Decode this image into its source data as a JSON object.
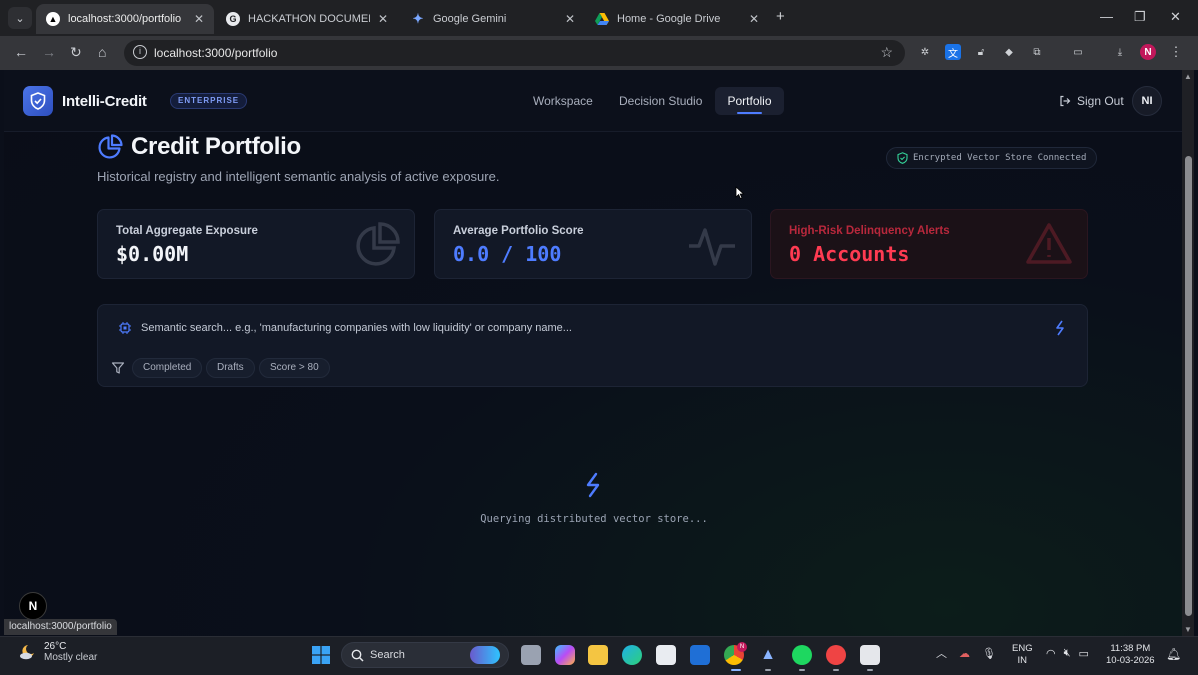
{
  "browser": {
    "tabs": [
      {
        "title": "localhost:3000/portfolio",
        "active": true
      },
      {
        "title": "HACKATHON DOCUMENTATIO",
        "active": false
      },
      {
        "title": "Google Gemini",
        "active": false
      },
      {
        "title": "Home - Google Drive",
        "active": false
      }
    ],
    "new_tab": "+",
    "url": "localhost:3000/portfolio",
    "profile_initial": "N",
    "status_url": "localhost:3000/portfolio"
  },
  "app": {
    "brand": "Intelli-Credit",
    "badge": "ENTERPRISE",
    "nav": [
      "Workspace",
      "Decision Studio",
      "Portfolio"
    ],
    "active_nav": "Portfolio",
    "sign_out": "Sign Out",
    "avatar_initials": "NI"
  },
  "page": {
    "title": "Credit Portfolio",
    "subtitle": "Historical registry and intelligent semantic analysis of active exposure.",
    "vector_status": "Encrypted Vector Store Connected",
    "cards": [
      {
        "label": "Total Aggregate Exposure",
        "value": "$0.00M",
        "accent": "#f2f4f8"
      },
      {
        "label": "Average Portfolio Score",
        "value": "0.0 / 100",
        "accent": "#4e7cff"
      },
      {
        "label": "High-Risk Delinquency Alerts",
        "value": "0 Accounts",
        "accent": "#ff3b52"
      }
    ],
    "search_placeholder": "Semantic search... e.g., 'manufacturing companies with low liquidity' or company name...",
    "filters": [
      "Completed",
      "Drafts",
      "Score > 80"
    ],
    "loading_text": "Querying distributed vector store...",
    "dev_badge": "N"
  },
  "taskbar": {
    "temperature": "26°C",
    "weather": "Mostly clear",
    "search_label": "Search",
    "chrome_badge": "N",
    "language": "ENG",
    "region": "IN",
    "time": "11:38 PM",
    "date": "10-03-2026"
  },
  "colors": {
    "accent_blue": "#4e7cff",
    "alert_red": "#ff3b52",
    "page_bg": "#0b0f1a"
  }
}
